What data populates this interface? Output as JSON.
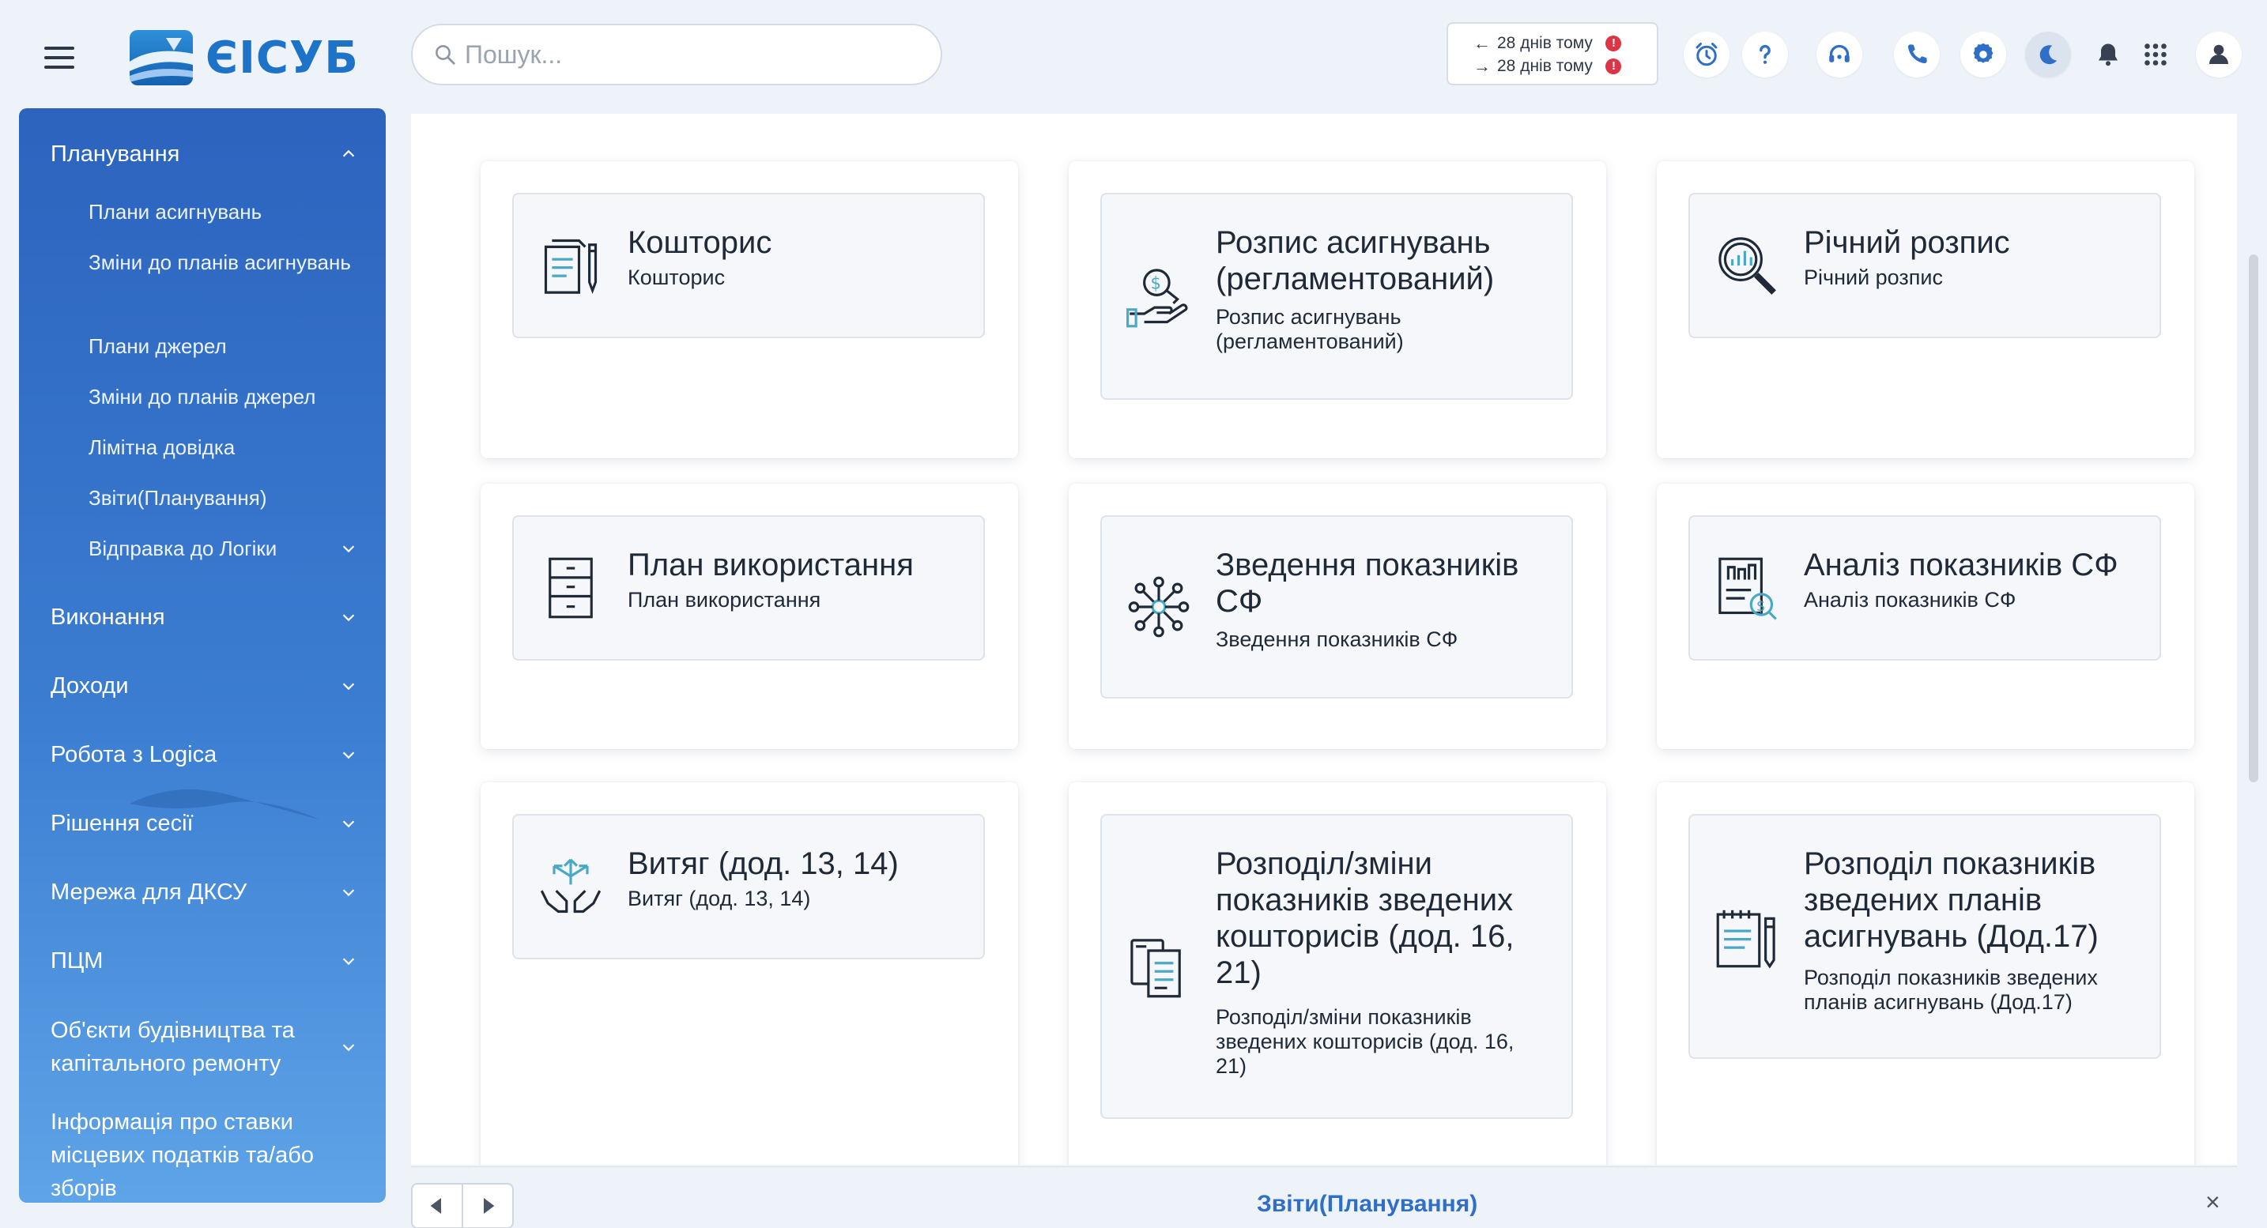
{
  "app": {
    "logo_text": "ЄІСУБ"
  },
  "search": {
    "placeholder": "Пошук..."
  },
  "sync": {
    "last_sent": "28 днів тому",
    "last_received": "28 днів тому"
  },
  "header_icons": [
    "alarm-clock-icon",
    "help-icon",
    "support-headset-icon",
    "phone-icon",
    "settings-gear-icon",
    "dark-mode-moon-icon",
    "notifications-bell-icon",
    "apps-grid-icon",
    "user-avatar-icon"
  ],
  "sidebar": {
    "sections": [
      {
        "label": "Планування",
        "expanded": true,
        "items": [
          "Плани асигнувань",
          "Зміни до планів асигнувань",
          "Плани джерел",
          "Зміни до планів джерел",
          "Лімітна довідка",
          "Звіти(Планування)",
          "Відправка до Логіки"
        ]
      },
      {
        "label": "Виконання"
      },
      {
        "label": "Доходи"
      },
      {
        "label": "Робота з Logica"
      },
      {
        "label": "Рішення сесії"
      },
      {
        "label": "Мережа для ДКСУ"
      },
      {
        "label": "ПЦМ"
      },
      {
        "label": "Об'єкти будівництва та капітального ремонту"
      },
      {
        "label": "Інформація про ставки місцевих податків та/або зборів"
      }
    ]
  },
  "cards": [
    {
      "title": "Кошторис",
      "subtitle": "Кошторис",
      "icon": "document-pen-icon"
    },
    {
      "title": "Розпис асигнувань (регламентований)",
      "subtitle": "Розпис асигнувань (регламентований)",
      "icon": "hand-coin-icon"
    },
    {
      "title": "Річний розпис",
      "subtitle": "Річний розпис",
      "icon": "magnifier-chart-icon"
    },
    {
      "title": "План використання",
      "subtitle": "План використання",
      "icon": "cabinet-icon"
    },
    {
      "title": "Зведення показників СФ",
      "subtitle": "Зведення показників СФ",
      "icon": "network-hub-icon"
    },
    {
      "title": "Аналіз показників СФ",
      "subtitle": "Аналіз показників СФ",
      "icon": "report-analysis-icon"
    },
    {
      "title": "Витяг (дод. 13, 14)",
      "subtitle": "Витяг (дод. 13, 14)",
      "icon": "hands-arrows-icon"
    },
    {
      "title": "Розподіл/зміни показників зведених кошторисів (дод. 16, 21)",
      "subtitle": "Розподіл/зміни показників зведених кошторисів (дод. 16, 21)",
      "icon": "documents-stack-icon"
    },
    {
      "title": "Розподіл показників зведених планів асигнувань (Дод.17)",
      "subtitle": "Розподіл показників зведених планів асигнувань (Дод.17)",
      "icon": "notepad-pencil-icon"
    }
  ],
  "bottom_bar": {
    "active_tab": "Звіти(Планування)",
    "close_symbol": "×"
  },
  "colors": {
    "accent": "#2f6fc7",
    "sidebar_top": "#2c63be",
    "sidebar_bottom": "#5ea4e8",
    "alert": "#dc3545"
  }
}
